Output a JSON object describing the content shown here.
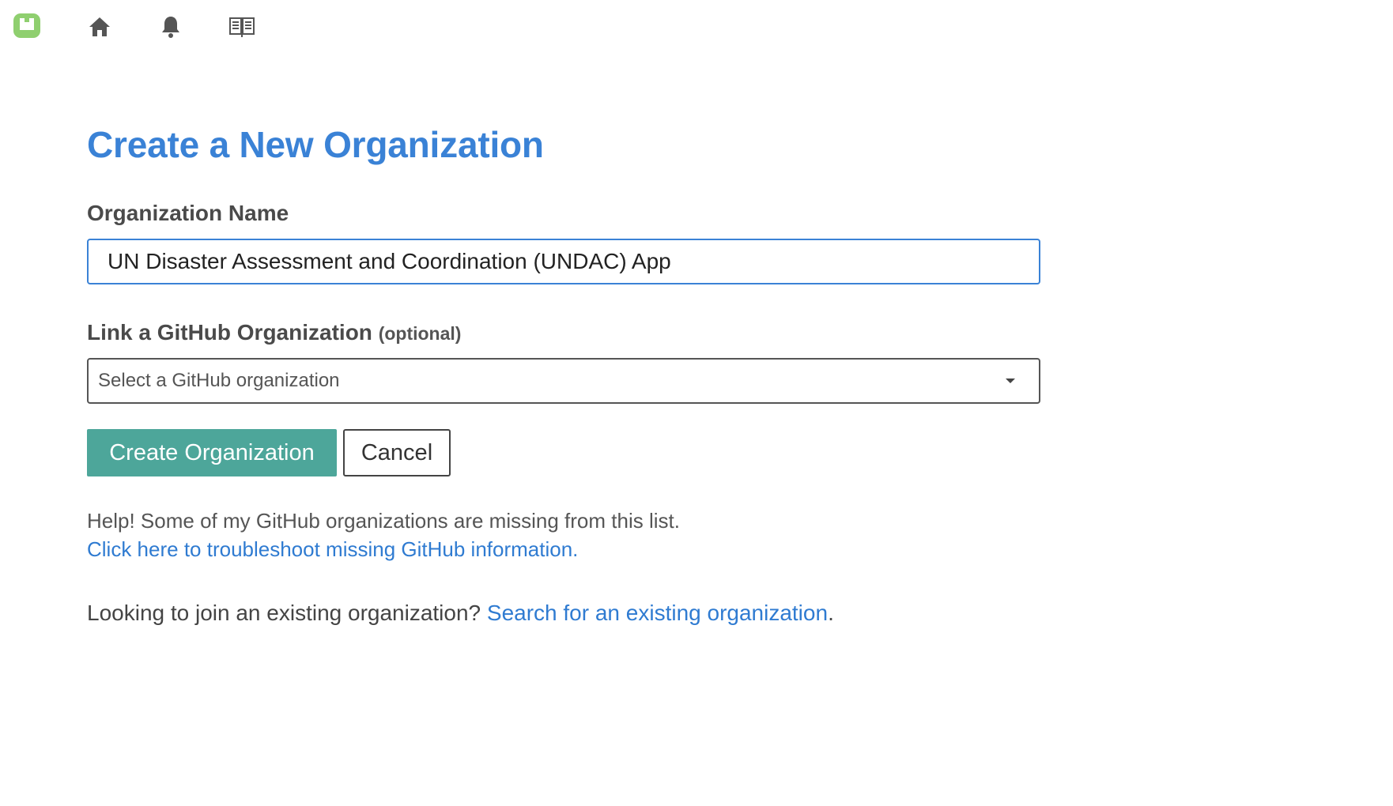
{
  "nav": {
    "logo_icon": "app-logo-icon",
    "home_icon": "home-icon",
    "notifications_icon": "bell-icon",
    "docs_icon": "book-icon",
    "logo_color": "#8fcf6f"
  },
  "page": {
    "title": "Create a New Organization"
  },
  "form": {
    "name_label": "Organization Name",
    "name_value": "UN Disaster Assessment and Coordination (UNDAC) App",
    "github_label": "Link a GitHub Organization",
    "github_optional": "(optional)",
    "github_placeholder": "Select a GitHub organization",
    "create_label": "Create Organization",
    "cancel_label": "Cancel"
  },
  "help": {
    "missing_text": "Help! Some of my GitHub organizations are missing from this list.",
    "troubleshoot_link": "Click here to troubleshoot missing GitHub information.",
    "join_prefix": "Looking to join an existing organization?",
    "join_link": "Search for an existing organization",
    "join_suffix": "."
  },
  "colors": {
    "title": "#3a82d6",
    "primary_button": "#4da69a",
    "link": "#2f7bd1"
  }
}
